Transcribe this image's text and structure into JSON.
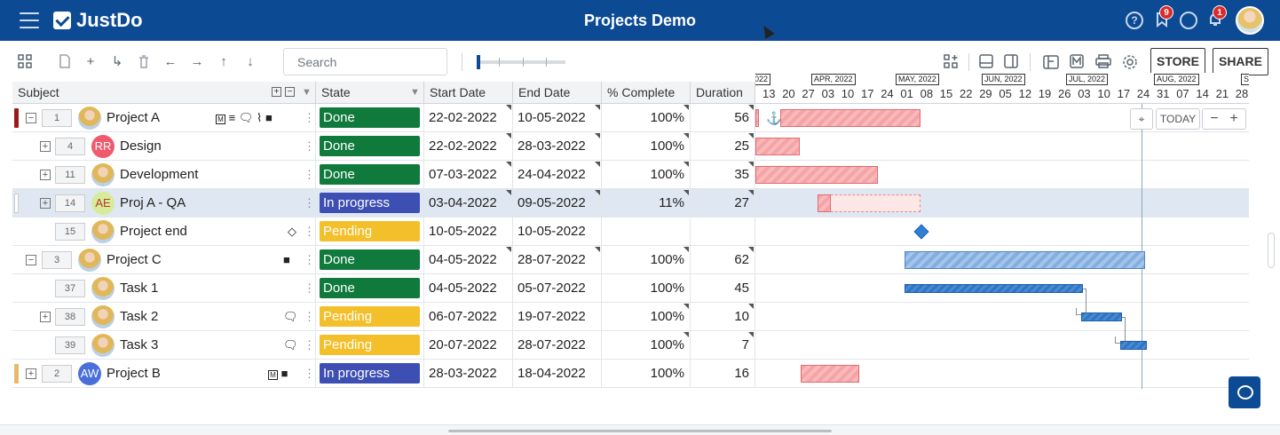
{
  "header": {
    "app_name": "JustDo",
    "title": "Projects Demo",
    "help_icon": "question-icon",
    "notifications_badge": "9",
    "alerts_badge": "1"
  },
  "toolbar": {
    "search_placeholder": "Search",
    "store_label": "STORE",
    "share_label": "SHARE"
  },
  "columns": {
    "subject": "Subject",
    "state": "State",
    "start_date": "Start Date",
    "end_date": "End Date",
    "percent": "% Complete",
    "duration": "Duration"
  },
  "timeline": {
    "months": [
      "022",
      "APR, 2022",
      "MAY, 2022",
      "JUN, 2022",
      "JUL, 2022",
      "AUG, 2022",
      "S"
    ],
    "days": [
      "13",
      "20",
      "27",
      "03",
      "10",
      "17",
      "24",
      "01",
      "08",
      "15",
      "22",
      "29",
      "05",
      "12",
      "19",
      "26",
      "03",
      "10",
      "17",
      "24",
      "31",
      "07",
      "14",
      "21",
      "28"
    ],
    "today_label": "TODAY",
    "zoom_out": "−",
    "zoom_in": "+"
  },
  "colors": {
    "done": "#0f7a3c",
    "in_progress": "#3d4fb3",
    "pending": "#f3bf2b",
    "brand": "#0d4a94"
  },
  "rows": [
    {
      "seq": "1",
      "subject": "Project A",
      "state": "Done",
      "start": "22-02-2022",
      "end": "10-05-2022",
      "pct": "100%",
      "dur": "56"
    },
    {
      "seq": "4",
      "subject": "Design",
      "avatar": "RR",
      "state": "Done",
      "start": "22-02-2022",
      "end": "28-03-2022",
      "pct": "100%",
      "dur": "25"
    },
    {
      "seq": "11",
      "subject": "Development",
      "state": "Done",
      "start": "07-03-2022",
      "end": "24-04-2022",
      "pct": "100%",
      "dur": "35"
    },
    {
      "seq": "14",
      "subject": "Proj A - QA",
      "avatar": "AE",
      "state": "In progress",
      "start": "03-04-2022",
      "end": "09-05-2022",
      "pct": "11%",
      "dur": "27"
    },
    {
      "seq": "15",
      "subject": "Project end",
      "state": "Pending",
      "start": "10-05-2022",
      "end": "10-05-2022",
      "pct": "",
      "dur": ""
    },
    {
      "seq": "3",
      "subject": "Project C",
      "state": "Done",
      "start": "04-05-2022",
      "end": "28-07-2022",
      "pct": "100%",
      "dur": "62"
    },
    {
      "seq": "37",
      "subject": "Task 1",
      "state": "Done",
      "start": "04-05-2022",
      "end": "05-07-2022",
      "pct": "100%",
      "dur": "45"
    },
    {
      "seq": "38",
      "subject": "Task 2",
      "state": "Pending",
      "start": "06-07-2022",
      "end": "19-07-2022",
      "pct": "100%",
      "dur": "10"
    },
    {
      "seq": "39",
      "subject": "Task 3",
      "state": "Pending",
      "start": "20-07-2022",
      "end": "28-07-2022",
      "pct": "100%",
      "dur": "7"
    },
    {
      "seq": "2",
      "subject": "Project B",
      "avatar": "AW",
      "state": "In progress",
      "start": "28-03-2022",
      "end": "18-04-2022",
      "pct": "100%",
      "dur": "16"
    }
  ]
}
